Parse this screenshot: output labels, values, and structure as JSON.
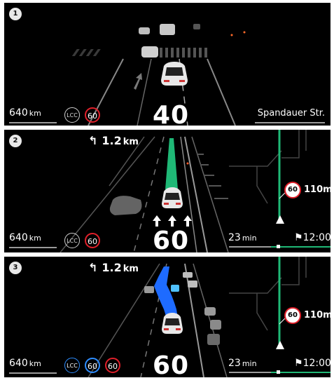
{
  "panels": [
    {
      "index": "1",
      "odometer": {
        "value": "640",
        "unit": "km"
      },
      "chips": [
        "LCC",
        "60"
      ],
      "speed": "40",
      "street": "Spandauer Str."
    },
    {
      "index": "2",
      "turn": {
        "distance": "1.2",
        "unit": "km"
      },
      "odometer": {
        "value": "640",
        "unit": "km"
      },
      "chips": [
        "LCC",
        "60"
      ],
      "speed": "60",
      "map": {
        "limit": "60",
        "distance": "110m",
        "eta_value": "23",
        "eta_unit": "min",
        "arrival": "12:00"
      }
    },
    {
      "index": "3",
      "turn": {
        "distance": "1.2",
        "unit": "km"
      },
      "odometer": {
        "value": "640",
        "unit": "km"
      },
      "chips": [
        "LCC",
        "60",
        "60"
      ],
      "speed": "60",
      "map": {
        "limit": "60",
        "distance": "110m",
        "eta_value": "23",
        "eta_unit": "min",
        "arrival": "12:00"
      }
    }
  ],
  "colors": {
    "route_green": "#1fb876",
    "route_blue": "#1e6bff",
    "limit_red": "#e0202a",
    "lcc_blue": "#2e8dff"
  }
}
